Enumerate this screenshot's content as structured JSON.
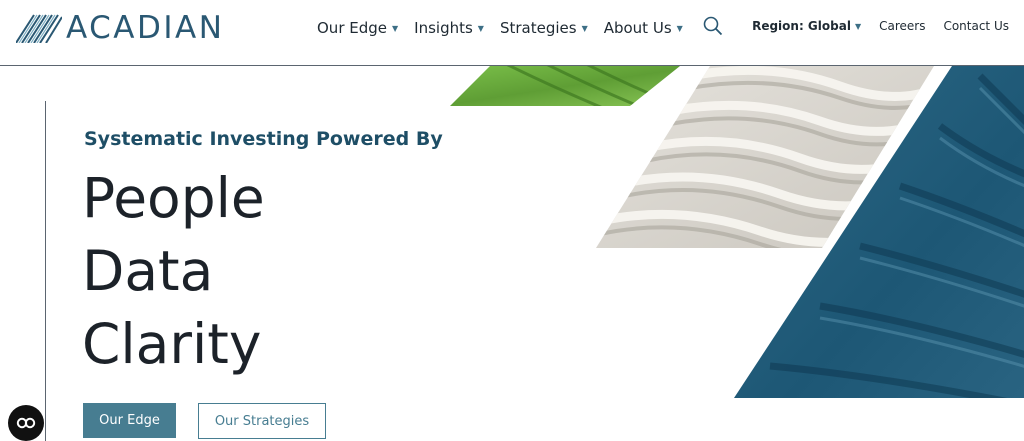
{
  "brand": {
    "name": "ACADIAN"
  },
  "nav": {
    "items": [
      {
        "label": "Our Edge"
      },
      {
        "label": "Insights"
      },
      {
        "label": "Strategies"
      },
      {
        "label": "About Us"
      }
    ]
  },
  "utility": {
    "region_label": "Region: Global",
    "careers": "Careers",
    "contact": "Contact Us"
  },
  "hero": {
    "kicker": "Systematic Investing Powered By",
    "words": [
      "People",
      "Data",
      "Clarity"
    ],
    "primary_button": "Our Edge",
    "secondary_button": "Our Strategies"
  },
  "colors": {
    "brand_blue": "#2a5873",
    "accent": "#477d91",
    "heading_blue": "#1e4e66"
  },
  "icons": {
    "search": "search-icon",
    "caret": "caret-down-icon",
    "accessibility": "accessibility-icon"
  }
}
